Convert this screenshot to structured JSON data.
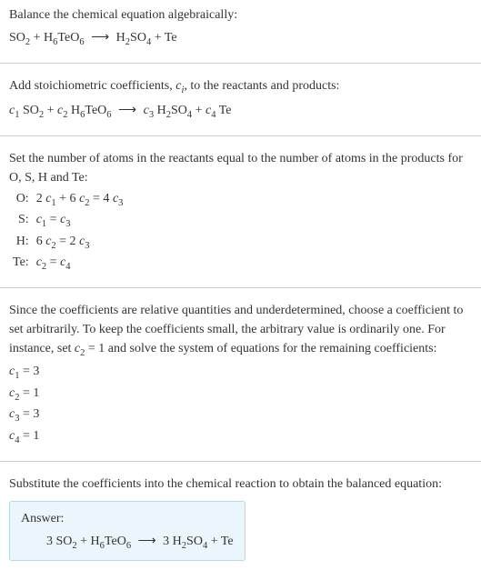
{
  "step1": {
    "text": "Balance the chemical equation algebraically:"
  },
  "step2": {
    "text_prefix": "Add stoichiometric coefficients, ",
    "text_suffix": ", to the reactants and products:"
  },
  "step3": {
    "text": "Set the number of atoms in the reactants equal to the number of atoms in the products for O, S, H and Te:"
  },
  "step4": {
    "text_prefix": "Since the coefficients are relative quantities and underdetermined, choose a coefficient to set arbitrarily. To keep the coefficients small, the arbitrary value is ordinarily one. For instance, set ",
    "text_mid": " = 1",
    "text_suffix": " and solve the system of equations for the remaining coefficients:"
  },
  "step5": {
    "text": "Substitute the coefficients into the chemical reaction to obtain the balanced equation:"
  },
  "answer": {
    "label": "Answer:"
  },
  "elements": {
    "O": "O:",
    "S": "S:",
    "H": "H:",
    "Te": "Te:"
  },
  "coefs": {
    "c1": "c₁ = 3",
    "c2": "c₂ = 1",
    "c3": "c₃ = 3",
    "c4": "c₄ = 1"
  }
}
